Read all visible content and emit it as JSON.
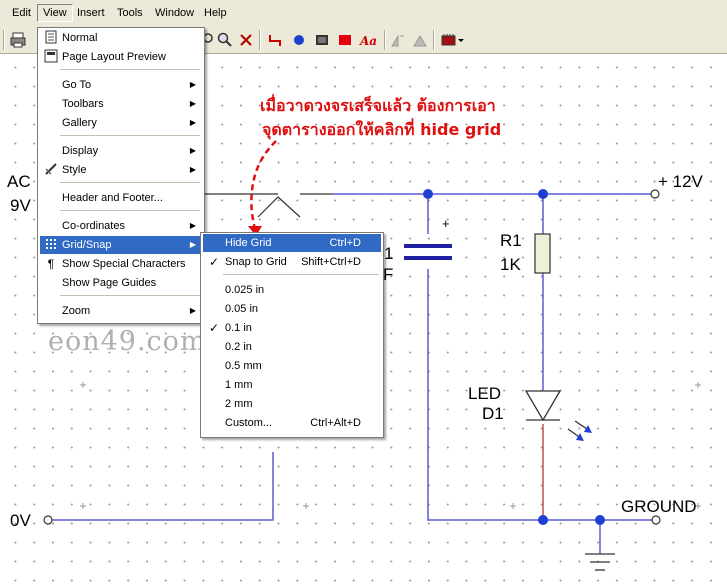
{
  "menubar": {
    "items": [
      {
        "label": "Edit"
      },
      {
        "label": "View"
      },
      {
        "label": "Insert"
      },
      {
        "label": "Tools"
      },
      {
        "label": "Window"
      },
      {
        "label": "Help"
      }
    ]
  },
  "toolbar": {
    "icons": [
      "print-icon",
      "search-icon",
      "delete-icon",
      "wire-icon",
      "junction-icon",
      "component-icon",
      "rectangle-icon",
      "text-icon",
      "flip-icon",
      "rotate-icon",
      "chip-icon"
    ]
  },
  "view_menu": {
    "items": [
      {
        "label": "Normal",
        "icon": "page-icon"
      },
      {
        "label": "Page Layout Preview",
        "icon": "page-layout-icon"
      },
      {
        "label": "Go To",
        "submenu": true
      },
      {
        "label": "Toolbars",
        "submenu": true
      },
      {
        "label": "Gallery",
        "submenu": true
      },
      {
        "label": "Display",
        "submenu": true
      },
      {
        "label": "Style",
        "submenu": true,
        "icon": "style-icon"
      },
      {
        "label": "Header and Footer..."
      },
      {
        "label": "Co-ordinates",
        "submenu": true
      },
      {
        "label": "Grid/Snap",
        "submenu": true,
        "icon": "grid-icon",
        "highlighted": true
      },
      {
        "label": "Show Special Characters",
        "icon": "pilcrow-icon"
      },
      {
        "label": "Show Page Guides"
      },
      {
        "label": "Zoom",
        "submenu": true
      }
    ]
  },
  "grid_menu": {
    "items": [
      {
        "label": "Hide Grid",
        "shortcut": "Ctrl+D",
        "highlighted": true
      },
      {
        "label": "Snap to Grid",
        "shortcut": "Shift+Ctrl+D",
        "checked": true
      },
      {
        "label": "0.025 in"
      },
      {
        "label": "0.05 in"
      },
      {
        "label": "0.1 in",
        "checked": true
      },
      {
        "label": "0.2 in"
      },
      {
        "label": "0.5 mm"
      },
      {
        "label": "1 mm"
      },
      {
        "label": "2 mm"
      },
      {
        "label": "Custom...",
        "shortcut": "Ctrl+Alt+D"
      }
    ]
  },
  "annotation": {
    "line1": "เมื่อวาดวงจรเสร็จแล้ว ต้องการเอา",
    "line2": "จุดตารางออกให้คลิกที่ hide grid"
  },
  "watermark": "eon49.com",
  "schematic": {
    "ac_label": "AC",
    "v9_label": "9V",
    "v0_label": "0V",
    "plus12_label": "+ 12V",
    "r_label": "R1",
    "r_value": "1K",
    "led_label": "LED",
    "led_ref": "D1",
    "ground_label": "GROUND",
    "cap_plus": "+",
    "cap_partial_1": "1",
    "cap_partial_f": "F"
  }
}
